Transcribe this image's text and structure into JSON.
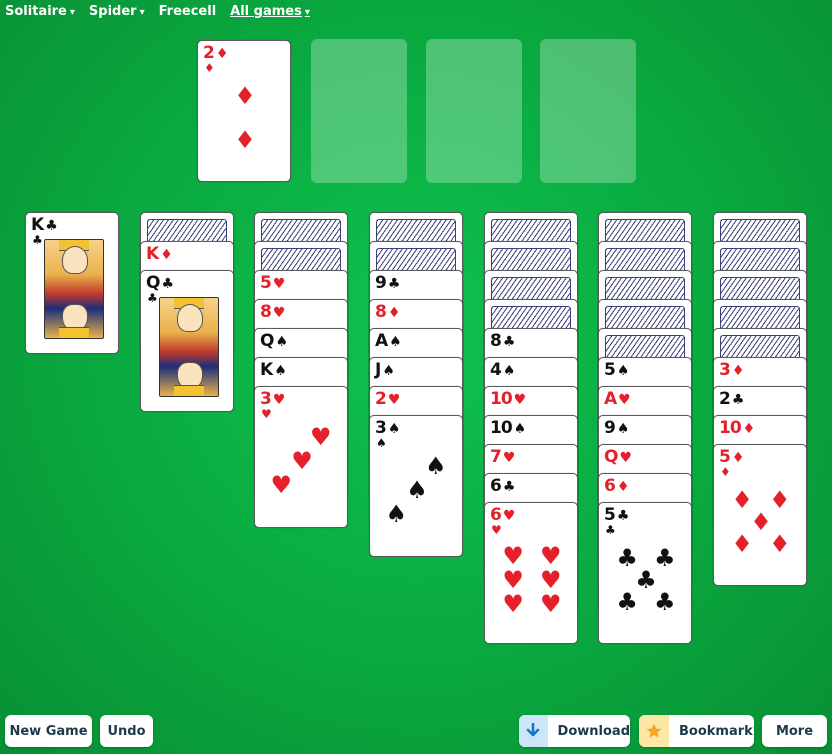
{
  "nav": [
    {
      "label": "Solitaire",
      "caret": "▾"
    },
    {
      "label": "Spider",
      "caret": "▾"
    },
    {
      "label": "Freecell",
      "caret": ""
    },
    {
      "label": "All games",
      "caret": "▾"
    }
  ],
  "foundations": [
    {
      "rank": "2",
      "suit": "♦",
      "color": "red",
      "filled": true
    },
    {
      "filled": false
    },
    {
      "filled": false
    },
    {
      "filled": false
    }
  ],
  "tableau": [
    {
      "down": 0,
      "up": [
        {
          "rank": "K",
          "suit": "♣",
          "color": "black",
          "face": "king"
        }
      ]
    },
    {
      "down": 1,
      "up": [
        {
          "rank": "K",
          "suit": "♦",
          "color": "red"
        },
        {
          "rank": "Q",
          "suit": "♣",
          "color": "black",
          "face": "queen"
        }
      ]
    },
    {
      "down": 2,
      "up": [
        {
          "rank": "5",
          "suit": "♥",
          "color": "red"
        },
        {
          "rank": "8",
          "suit": "♥",
          "color": "red"
        },
        {
          "rank": "Q",
          "suit": "♠",
          "color": "black"
        },
        {
          "rank": "K",
          "suit": "♠",
          "color": "black"
        },
        {
          "rank": "3",
          "suit": "♥",
          "color": "red"
        }
      ]
    },
    {
      "down": 2,
      "up": [
        {
          "rank": "9",
          "suit": "♣",
          "color": "black"
        },
        {
          "rank": "8",
          "suit": "♦",
          "color": "red"
        },
        {
          "rank": "A",
          "suit": "♠",
          "color": "black"
        },
        {
          "rank": "J",
          "suit": "♠",
          "color": "black"
        },
        {
          "rank": "2",
          "suit": "♥",
          "color": "red"
        },
        {
          "rank": "3",
          "suit": "♠",
          "color": "black"
        }
      ]
    },
    {
      "down": 4,
      "up": [
        {
          "rank": "8",
          "suit": "♣",
          "color": "black"
        },
        {
          "rank": "4",
          "suit": "♠",
          "color": "black"
        },
        {
          "rank": "10",
          "suit": "♥",
          "color": "red"
        },
        {
          "rank": "10",
          "suit": "♠",
          "color": "black"
        },
        {
          "rank": "7",
          "suit": "♥",
          "color": "red"
        },
        {
          "rank": "6",
          "suit": "♣",
          "color": "black"
        },
        {
          "rank": "6",
          "suit": "♥",
          "color": "red"
        }
      ]
    },
    {
      "down": 5,
      "up": [
        {
          "rank": "5",
          "suit": "♠",
          "color": "black"
        },
        {
          "rank": "A",
          "suit": "♥",
          "color": "red"
        },
        {
          "rank": "9",
          "suit": "♠",
          "color": "black"
        },
        {
          "rank": "Q",
          "suit": "♥",
          "color": "red"
        },
        {
          "rank": "6",
          "suit": "♦",
          "color": "red"
        },
        {
          "rank": "5",
          "suit": "♣",
          "color": "black"
        }
      ]
    },
    {
      "down": 5,
      "up": [
        {
          "rank": "3",
          "suit": "♦",
          "color": "red"
        },
        {
          "rank": "2",
          "suit": "♣",
          "color": "black"
        },
        {
          "rank": "10",
          "suit": "♦",
          "color": "red"
        },
        {
          "rank": "5",
          "suit": "♦",
          "color": "red"
        }
      ]
    }
  ],
  "buttons": {
    "new_game": "New Game",
    "undo": "Undo",
    "download": "Download",
    "bookmark": "Bookmark",
    "more": "More"
  },
  "colors": {
    "felt": "#0aa83f",
    "red_suit": "#e4202a",
    "black_suit": "#111111",
    "card_back": "#3a3f7a",
    "download_icon_bg": "#cde6f7",
    "bookmark_icon_bg": "#fde7a6"
  }
}
